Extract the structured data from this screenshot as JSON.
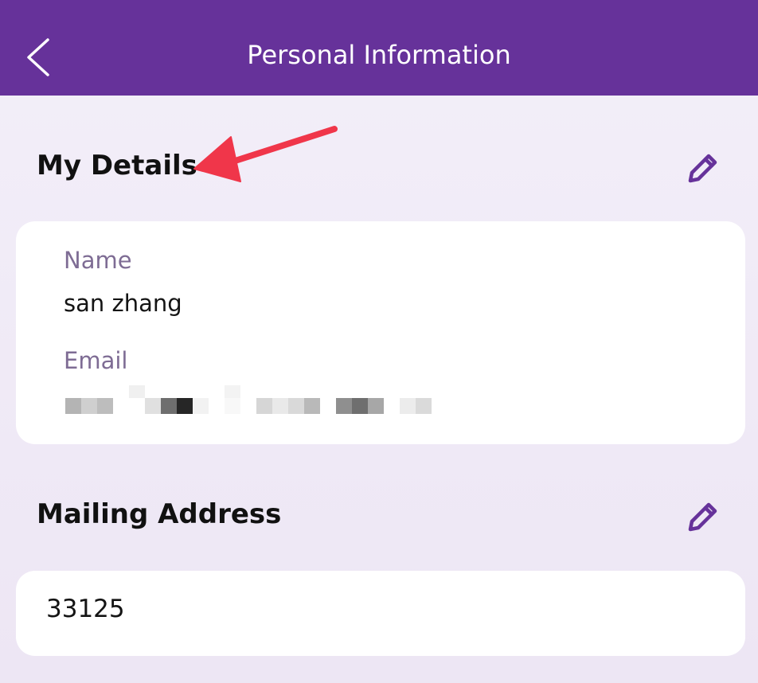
{
  "header": {
    "title": "Personal Information",
    "back_icon": "chevron-left-icon",
    "background_color": "#66329a"
  },
  "my_details": {
    "title": "My Details",
    "edit_icon": "pencil-icon",
    "name_label": "Name",
    "name_value": "san zhang",
    "email_label": "Email"
  },
  "mailing_address": {
    "title": "Mailing Address",
    "edit_icon": "pencil-icon",
    "value": "33125"
  },
  "colors": {
    "accent": "#66329a",
    "annotation_arrow": "#f0364a",
    "label": "#7e6c94"
  }
}
